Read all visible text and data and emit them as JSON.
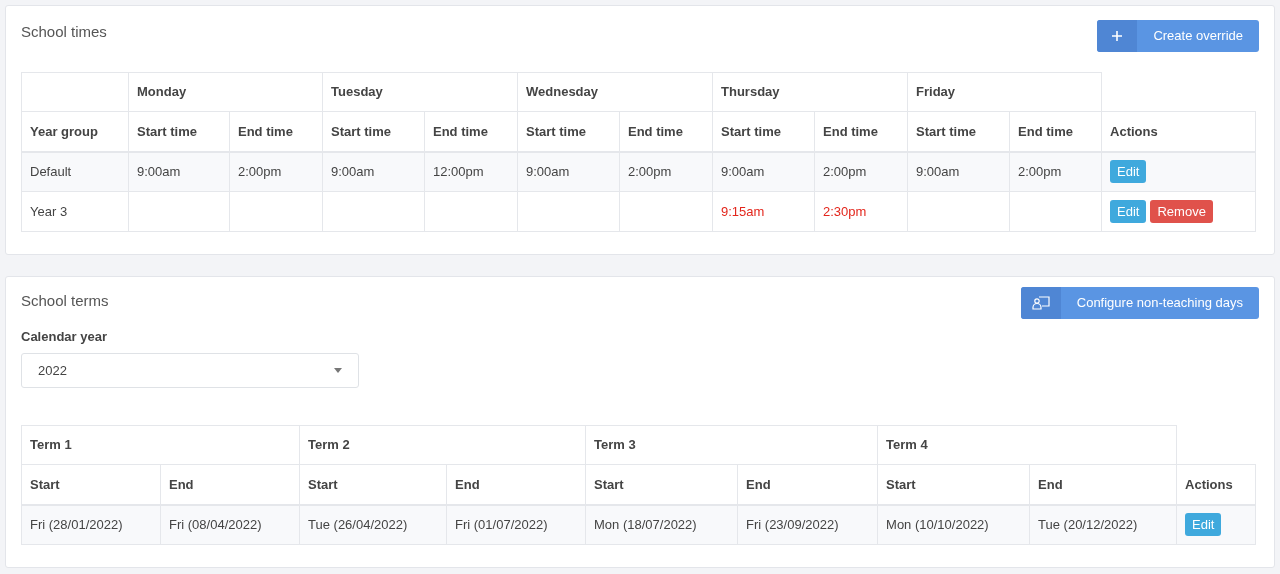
{
  "school_times": {
    "title": "School times",
    "create_button": {
      "label": "Create override"
    },
    "table": {
      "year_group_header": "Year group",
      "actions_header": "Actions",
      "days": [
        {
          "name": "Monday",
          "start_header": "Start time",
          "end_header": "End time"
        },
        {
          "name": "Tuesday",
          "start_header": "Start time",
          "end_header": "End time"
        },
        {
          "name": "Wednesday",
          "start_header": "Start time",
          "end_header": "End time"
        },
        {
          "name": "Thursday",
          "start_header": "Start time",
          "end_header": "End time"
        },
        {
          "name": "Friday",
          "start_header": "Start time",
          "end_header": "End time"
        }
      ],
      "rows": [
        {
          "year_group": "Default",
          "override": false,
          "times": {
            "monday": {
              "start": "9:00am",
              "end": "2:00pm"
            },
            "tuesday": {
              "start": "9:00am",
              "end": "12:00pm"
            },
            "wednesday": {
              "start": "9:00am",
              "end": "2:00pm"
            },
            "thursday": {
              "start": "9:00am",
              "end": "2:00pm"
            },
            "friday": {
              "start": "9:00am",
              "end": "2:00pm"
            }
          },
          "actions": [
            {
              "kind": "edit",
              "label": "Edit"
            }
          ]
        },
        {
          "year_group": "Year 3",
          "override": true,
          "times": {
            "thursday": {
              "start": "9:15am",
              "end": "2:30pm"
            }
          },
          "actions": [
            {
              "kind": "edit",
              "label": "Edit"
            },
            {
              "kind": "remove",
              "label": "Remove"
            }
          ]
        }
      ]
    }
  },
  "school_terms": {
    "title": "School terms",
    "configure_button": {
      "label": "Configure non-teaching days"
    },
    "calendar_year": {
      "label": "Calendar year",
      "value": "2022"
    },
    "table": {
      "actions_header": "Actions",
      "terms": [
        {
          "name": "Term 1",
          "start_header": "Start",
          "end_header": "End"
        },
        {
          "name": "Term 2",
          "start_header": "Start",
          "end_header": "End"
        },
        {
          "name": "Term 3",
          "start_header": "Start",
          "end_header": "End"
        },
        {
          "name": "Term 4",
          "start_header": "Start",
          "end_header": "End"
        }
      ],
      "rows": [
        {
          "dates": [
            {
              "start": "Fri (28/01/2022)",
              "end": "Fri (08/04/2022)"
            },
            {
              "start": "Tue (26/04/2022)",
              "end": "Fri (01/07/2022)"
            },
            {
              "start": "Mon (18/07/2022)",
              "end": "Fri (23/09/2022)"
            },
            {
              "start": "Mon (10/10/2022)",
              "end": "Tue (20/12/2022)"
            }
          ],
          "actions": [
            {
              "kind": "edit",
              "label": "Edit"
            }
          ]
        }
      ]
    }
  }
}
